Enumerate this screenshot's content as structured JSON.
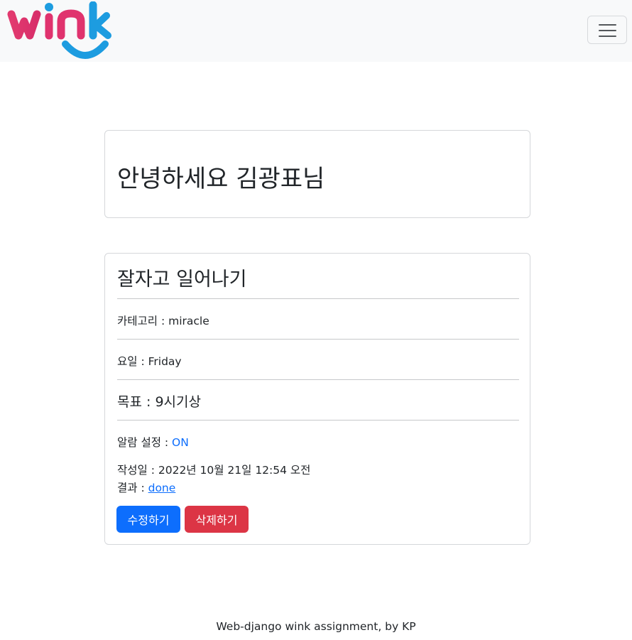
{
  "brand": {
    "logo_text": "wink",
    "colors": {
      "pink": "#e0336e",
      "blue": "#1d9ce0"
    }
  },
  "navbar": {
    "toggler_icon": "hamburger-menu-icon"
  },
  "greeting": "안녕하세요 김광표님",
  "mission": {
    "title": "잘자고 일어나기",
    "category_label": "카테고리 : ",
    "category_value": "miracle",
    "day_label": "요일 : ",
    "day_value": "Friday",
    "goal_label": "목표 : ",
    "goal_value": "9시기상",
    "alarm_label": "알람 설정 : ",
    "alarm_value": "ON",
    "created_label": "작성일 : ",
    "created_value": "2022년 10월 21일 12:54 오전",
    "result_label": "결과 : ",
    "result_value": "done"
  },
  "buttons": {
    "edit": "수정하기",
    "delete": "삭제하기"
  },
  "colors": {
    "primary": "#0d6efd",
    "danger": "#dc3545"
  },
  "footer": "Web-django wink assignment, by KP"
}
